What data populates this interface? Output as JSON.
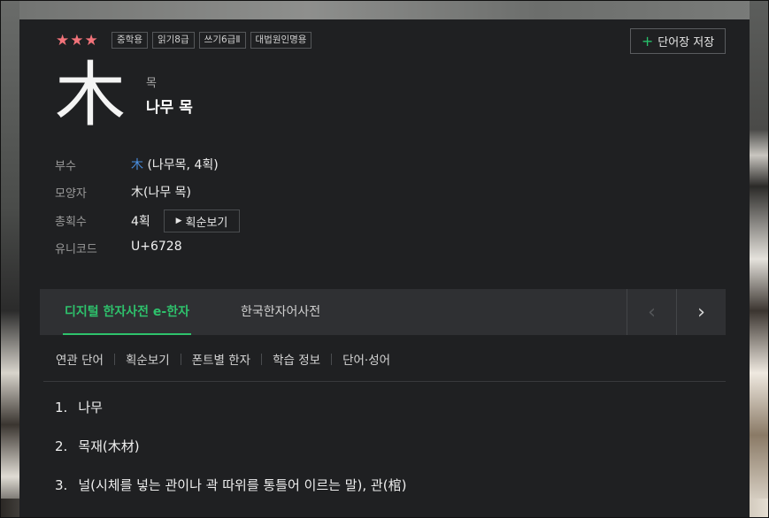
{
  "rating_stars": "★★★",
  "tags": [
    "중학용",
    "읽기8급",
    "쓰기6급Ⅱ",
    "대법원인명용"
  ],
  "save_button": {
    "icon": "plus-icon",
    "label": "단어장 저장"
  },
  "hanja": "木",
  "reading_small": "목",
  "reading_main": "나무 목",
  "info": {
    "radical": {
      "label": "부수",
      "char": "木",
      "rest": " (나무목, 4획)"
    },
    "shape": {
      "label": "모양자",
      "value": "木(나무 목)"
    },
    "strokes": {
      "label": "총획수",
      "value": "4획",
      "button": "획순보기"
    },
    "unicode": {
      "label": "유니코드",
      "value": "U+6728"
    }
  },
  "tabs": [
    "디지털 한자사전 e-한자",
    "한국한자어사전"
  ],
  "nav": {
    "prev": "‹",
    "next": "›"
  },
  "submenu": [
    "연관 단어",
    "획순보기",
    "폰트별 한자",
    "학습 정보",
    "단어·성어"
  ],
  "meanings": [
    {
      "num": "1.",
      "text": "나무"
    },
    {
      "num": "2.",
      "text": "목재(木材)"
    },
    {
      "num": "3.",
      "text": "널(시체를 넣는 관이나 곽 따위를 통틀어 이르는 말), 관(棺)"
    }
  ],
  "colors": {
    "accent": "#2ec26c",
    "link": "#4a8fe0",
    "stars": "#f2737a",
    "panel": "#1f2022",
    "tabbar": "#2f3033"
  }
}
